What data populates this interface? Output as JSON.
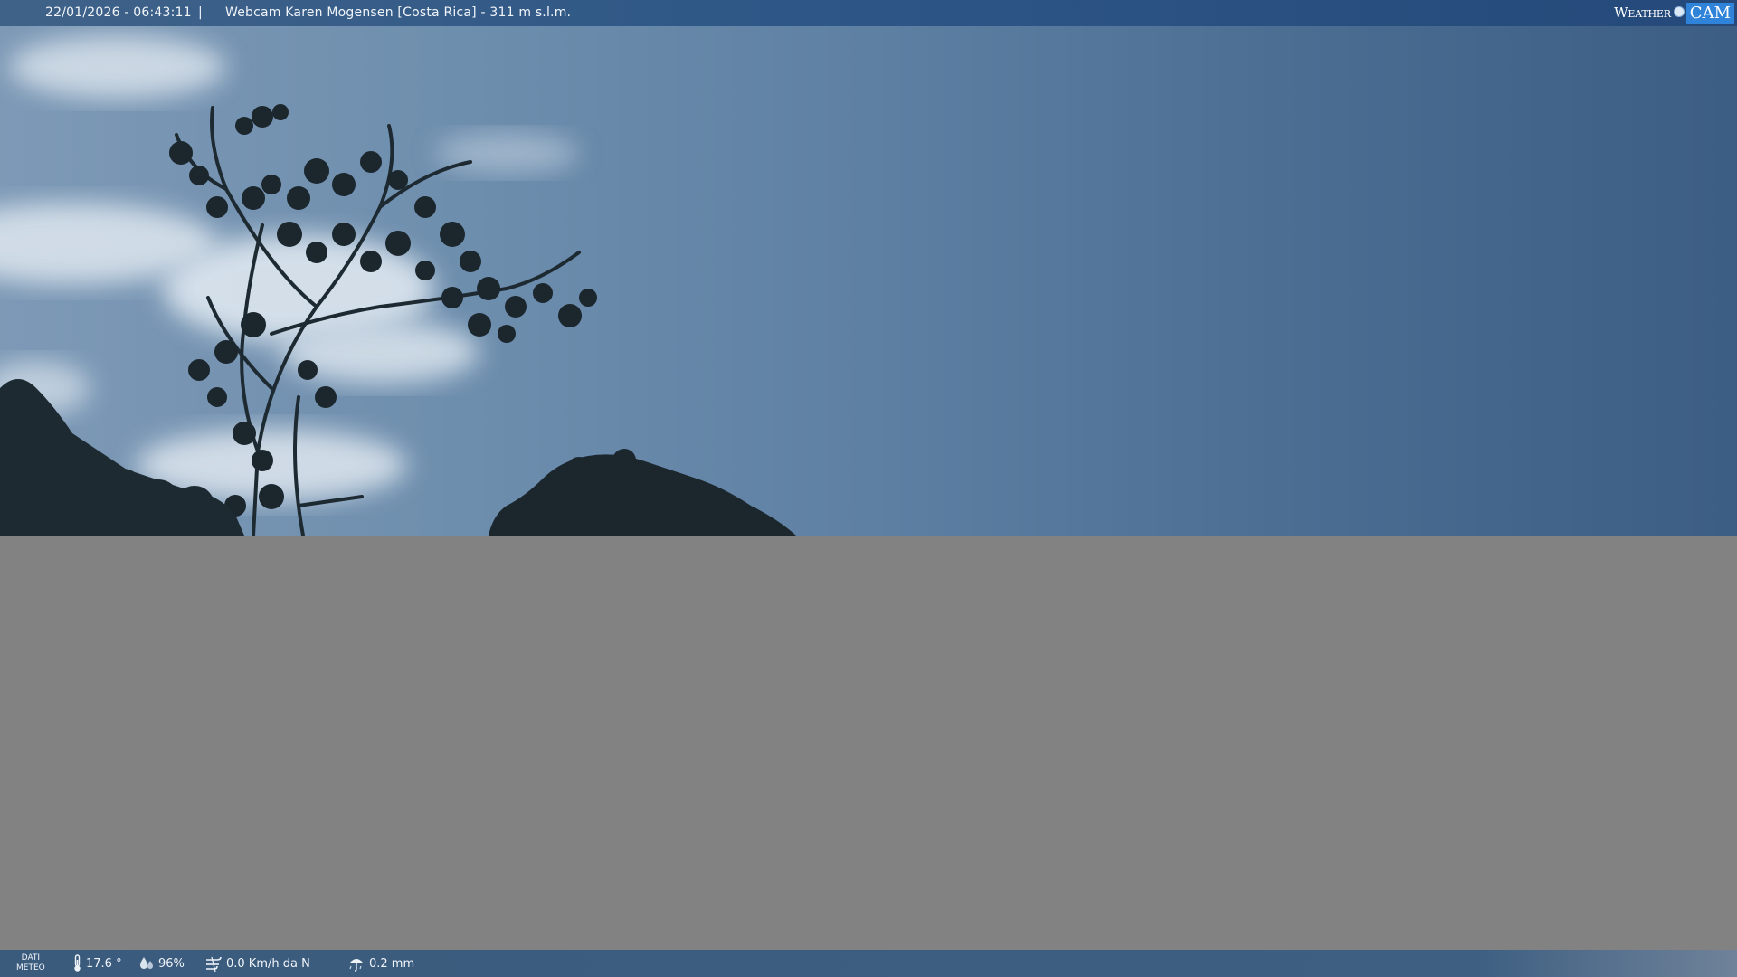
{
  "header": {
    "timestamp": "22/01/2026 - 06:43:11",
    "separator": "|",
    "camera_title": "Webcam Karen Mogensen [Costa Rica]  - 311 m s.l.m.",
    "logo_weather": "Weather",
    "logo_cam": "CAM"
  },
  "footer": {
    "dati_line1": "DATI",
    "dati_line2": "METEO",
    "temperature": "17.6 °",
    "humidity": "96%",
    "wind": "0.0 Km/h da N",
    "rain": "0.2 mm"
  },
  "icons": {
    "temperature": "thermometer-icon",
    "humidity": "humidity-drops-icon",
    "wind": "wind-icon",
    "rain": "rain-icon"
  },
  "colors": {
    "header_bar": "#2e5787",
    "logo_accent": "#2f83d9",
    "sky_left": "#7d99b6",
    "sky_right": "#3c5d84",
    "missing_area": "#828282",
    "footer_bar": "#3e5f82"
  }
}
